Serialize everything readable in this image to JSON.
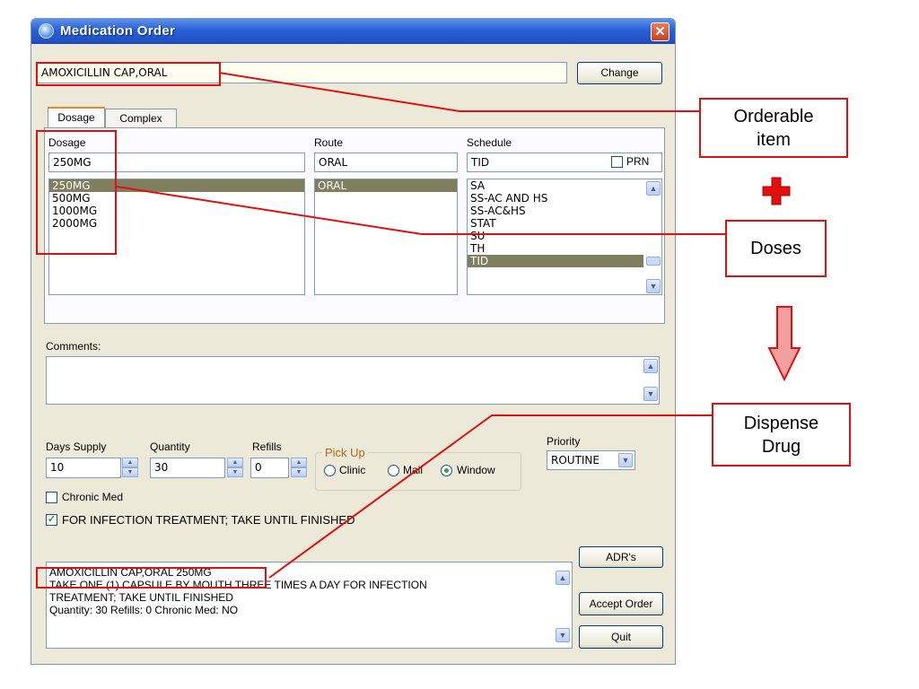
{
  "window": {
    "title": "Medication Order",
    "close_glyph": "✕"
  },
  "orderable": {
    "value": "AMOXICILLIN CAP,ORAL",
    "change_label": "Change"
  },
  "tabs": [
    {
      "label": "Dosage"
    },
    {
      "label": "Complex"
    }
  ],
  "dosage": {
    "label": "Dosage",
    "value": "250MG",
    "options": [
      "250MG",
      "500MG",
      "1000MG",
      "2000MG"
    ],
    "selected": "250MG"
  },
  "route": {
    "label": "Route",
    "value": "ORAL",
    "options": [
      "ORAL"
    ],
    "selected": "ORAL"
  },
  "schedule": {
    "label": "Schedule",
    "value": "TID",
    "prn_label": "PRN",
    "options": [
      "SA",
      "SS-AC AND HS",
      "SS-AC&HS",
      "STAT",
      "SU",
      "TH",
      "TID"
    ],
    "selected": "TID"
  },
  "comments": {
    "label": "Comments:",
    "value": ""
  },
  "supply": {
    "days_label": "Days Supply",
    "days_value": "10",
    "quantity_label": "Quantity",
    "quantity_value": "30",
    "refills_label": "Refills",
    "refills_value": "0"
  },
  "pickup": {
    "label": "Pick Up",
    "options": [
      "Clinic",
      "Mail",
      "Window"
    ],
    "selected": "Window"
  },
  "priority": {
    "label": "Priority",
    "value": "ROUTINE"
  },
  "chronic": {
    "label": "Chronic Med",
    "checked": false
  },
  "indication": {
    "label": "FOR INFECTION TREATMENT; TAKE UNTIL FINISHED",
    "checked": true
  },
  "summary": {
    "line1": "AMOXICILLIN CAP,ORAL  250MG",
    "line2": "TAKE ONE (1) CAPSULE BY MOUTH THREE TIMES A DAY FOR INFECTION",
    "line3": "TREATMENT; TAKE UNTIL FINISHED",
    "line4": "Quantity: 30 Refills: 0 Chronic Med: NO"
  },
  "buttons": {
    "adrs": "ADR's",
    "accept": "Accept Order",
    "quit": "Quit"
  },
  "annotations": {
    "orderable_item": [
      "Orderable",
      "item"
    ],
    "doses": "Doses",
    "dispense_drug": [
      "Dispense",
      "Drug"
    ],
    "color": "#e01010"
  }
}
